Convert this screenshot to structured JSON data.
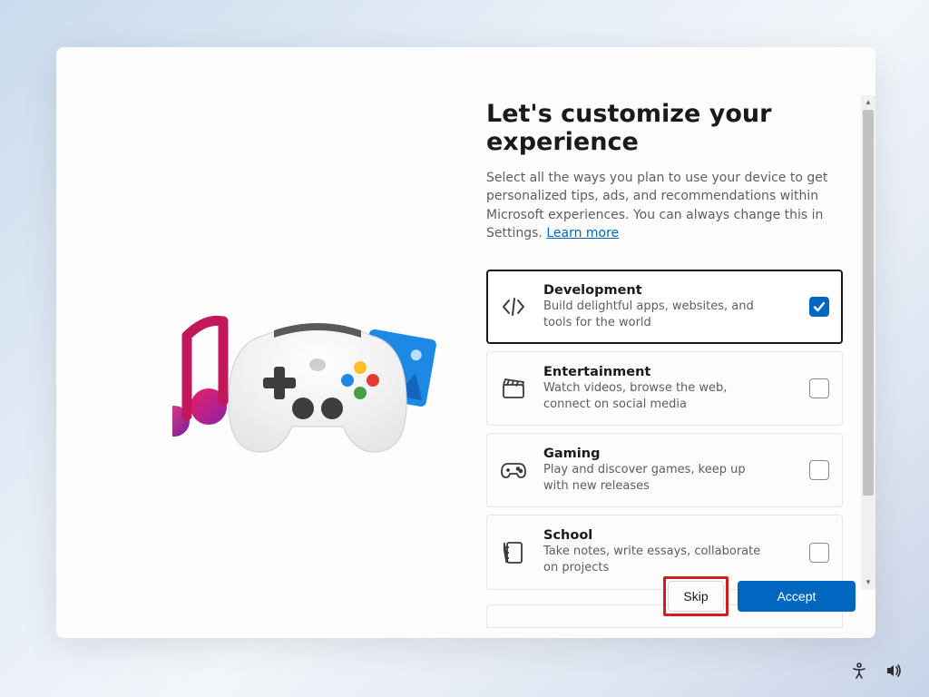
{
  "heading": "Let's customize your experience",
  "subtitle_a": "Select all the ways you plan to use your device to get personalized tips, ads, and recommendations within Microsoft experiences. You can always change this in Settings. ",
  "learn_more": "Learn more",
  "options": [
    {
      "title": "Development",
      "desc": "Build delightful apps, websites, and tools for the world",
      "checked": true,
      "icon": "code"
    },
    {
      "title": "Entertainment",
      "desc": "Watch videos, browse the web, connect on social media",
      "checked": false,
      "icon": "clapper"
    },
    {
      "title": "Gaming",
      "desc": "Play and discover games, keep up with new releases",
      "checked": false,
      "icon": "gamepad"
    },
    {
      "title": "School",
      "desc": "Take notes, write essays, collaborate on projects",
      "checked": false,
      "icon": "notebook"
    }
  ],
  "buttons": {
    "skip": "Skip",
    "accept": "Accept"
  },
  "colors": {
    "accent": "#0067c0",
    "highlight_border": "#d31c1c"
  }
}
